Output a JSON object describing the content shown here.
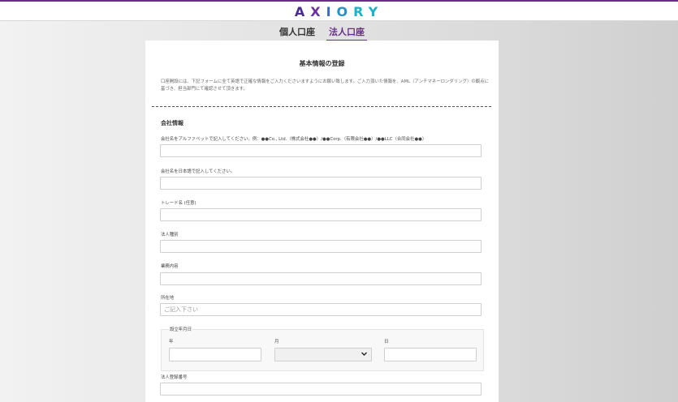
{
  "brand": {
    "logo_letters": [
      "A",
      "X",
      "I",
      "O",
      "R",
      "Y"
    ]
  },
  "tabs": [
    {
      "label": "個人口座",
      "active": false
    },
    {
      "label": "法人口座",
      "active": true
    }
  ],
  "form": {
    "title": "基本情報の登録",
    "intro": "口座開設には、下記フォームに全て英語で正確な情報をご入力くださいますようにお願い致します。ご入力頂いた情報を、AML（アンチマネーロンダリング）の観点に基づき、担当部門にて確認させて頂きます。",
    "section_title": "会社情報",
    "fields": {
      "company_name_en": {
        "label": "会社名をアルファベットで記入してください。例：●●Co., Ltd.（株式会社●●）/●●Corp.（有限会社●●）/●●LLC（合同会社●●）",
        "value": ""
      },
      "company_name_jp": {
        "label": "会社名を日本語で記入してください。",
        "value": ""
      },
      "trade_name": {
        "label": "トレード名 (任意)",
        "value": ""
      },
      "entity_type": {
        "label": "法人種別",
        "value": ""
      },
      "business": {
        "label": "業務内容",
        "value": ""
      },
      "address": {
        "label": "所在地",
        "placeholder": "ご記入下さい"
      },
      "established": {
        "legend": "設立年月日",
        "year_label": "年",
        "month_label": "月",
        "day_label": "日",
        "month_value": ""
      },
      "registration_number": {
        "label": "法人登録番号",
        "value": ""
      }
    }
  },
  "colors": {
    "accent": "#6a2c8c"
  },
  "icons": {
    "select_arrow": "chevron-down-icon"
  }
}
